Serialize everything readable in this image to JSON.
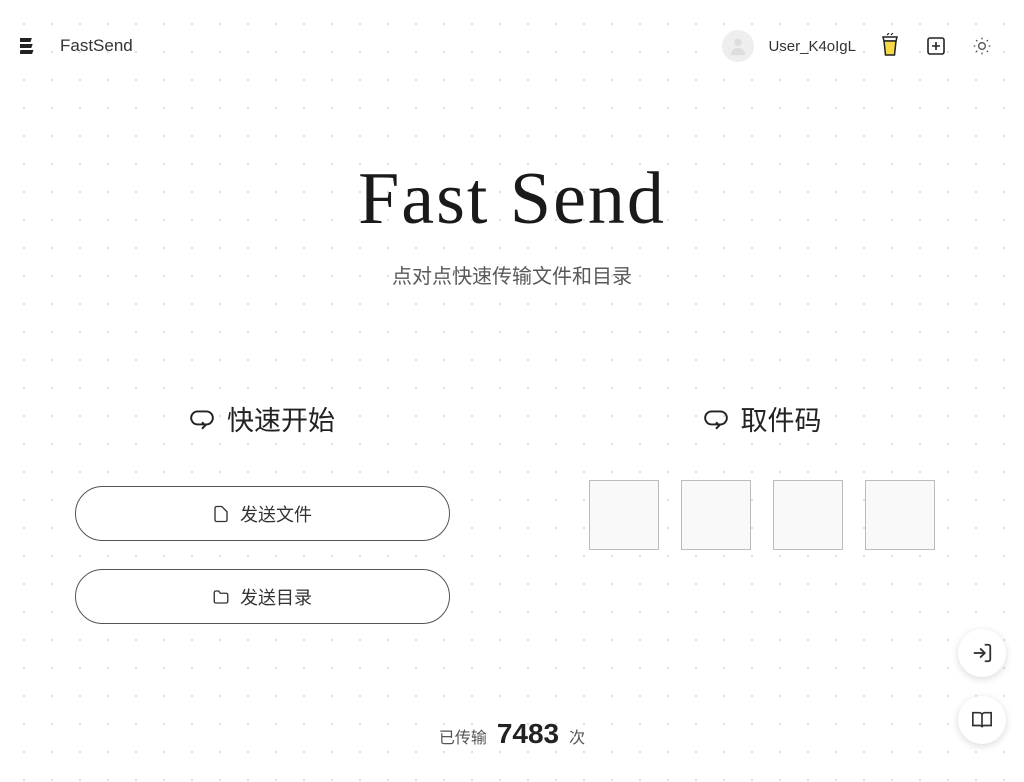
{
  "header": {
    "app_name": "FastSend",
    "username": "User_K4oIgL"
  },
  "hero": {
    "title": "Fast Send",
    "subtitle": "点对点快速传输文件和目录"
  },
  "quick_start": {
    "heading": "快速开始",
    "send_file_label": "发送文件",
    "send_dir_label": "发送目录"
  },
  "pickup": {
    "heading": "取件码"
  },
  "stats": {
    "prefix": "已传输",
    "count": "7483",
    "suffix": "次"
  }
}
